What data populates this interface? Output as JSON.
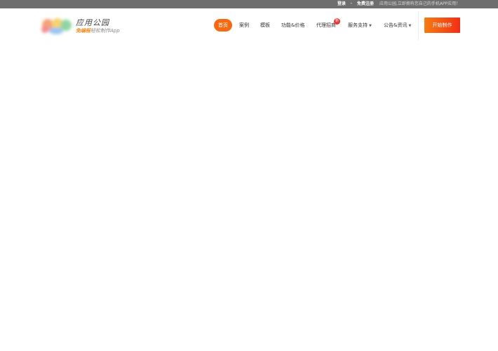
{
  "topbar": {
    "login": "登录",
    "separator": "•",
    "register": "免费注册",
    "slogan": "应用公园,立即拥有您自己的手机APP应用！"
  },
  "logo": {
    "name": "应用公园",
    "tagline_highlight": "免编程",
    "tagline_rest": "轻松制作App"
  },
  "nav": {
    "items": [
      {
        "label": "首页"
      },
      {
        "label": "案例"
      },
      {
        "label": "模板"
      },
      {
        "label": "功能&价格"
      },
      {
        "label": "代理招商"
      },
      {
        "label": "服务支持"
      },
      {
        "label": "公告&资讯"
      }
    ],
    "badge": "新"
  },
  "cta": {
    "label": "开始制作"
  },
  "colors": {
    "accent": "#f56a12",
    "badge": "#e8332a",
    "topbar": "#6e6e6e"
  }
}
